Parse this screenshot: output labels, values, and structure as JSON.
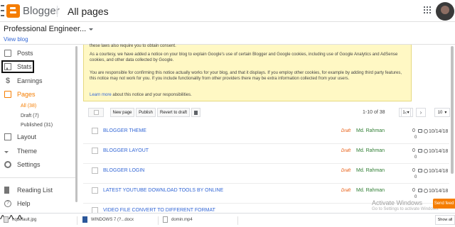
{
  "header": {
    "brand": "Blogger",
    "page_title": "All pages"
  },
  "blog": {
    "name": "Professional Engineer...",
    "view_blog": "View blog"
  },
  "sidebar": {
    "items": [
      {
        "label": "Posts",
        "icon": "posts-icon"
      },
      {
        "label": "Stats",
        "icon": "stats-icon"
      },
      {
        "label": "Earnings",
        "icon": "earnings-icon"
      },
      {
        "label": "Pages",
        "icon": "pages-icon",
        "active": true
      },
      {
        "label": "Layout",
        "icon": "layout-icon"
      },
      {
        "label": "Theme",
        "icon": "theme-icon"
      },
      {
        "label": "Settings",
        "icon": "settings-icon"
      },
      {
        "label": "Reading List",
        "icon": "reading-list-icon"
      },
      {
        "label": "Help",
        "icon": "help-icon"
      }
    ],
    "pages_sub": [
      {
        "label": "All (38)",
        "active": true
      },
      {
        "label": "Draft (7)"
      },
      {
        "label": "Published (31)"
      }
    ]
  },
  "notice": {
    "line1": "these laws also require you to obtain consent.",
    "para2": "As a courtesy, we have added a notice on your blog to explain Google's use of certain Blogger and Google cookies, including use of Google Analytics and AdSense cookies, and other data collected by Google.",
    "para3": "You are responsible for confirming this notice actually works for your blog, and that it displays. If you employ other cookies, for example by adding third party features, this notice may not work for you. If you include functionality from other providers there may be extra information collected from your users.",
    "learn_more": "Learn more",
    "learn_more_rest": " about this notice and your responsibilities."
  },
  "toolbar": {
    "new_page": "New page",
    "publish": "Publish",
    "revert": "Revert to draft",
    "count": "1-10 of 38",
    "page": "1",
    "per_page": "10"
  },
  "pages": [
    {
      "title": "BLOGGER THEME",
      "status": "Draft",
      "author": "Md. Rahman",
      "comments": "0",
      "views": "0",
      "date": "10/14/18"
    },
    {
      "title": "BLOGGER LAYOUT",
      "status": "Draft",
      "author": "Md. Rahman",
      "comments": "0",
      "views": "0",
      "date": "10/14/18"
    },
    {
      "title": "BLOGGER LOGIN",
      "status": "Draft",
      "author": "Md. Rahman",
      "comments": "0",
      "views": "0",
      "date": "10/14/18"
    },
    {
      "title": "LATEST YOUTUBE DOWNLOAD TOOLS BY ONLINE",
      "status": "Draft",
      "author": "Md. Rahman",
      "comments": "0",
      "views": "0",
      "date": "10/14/18"
    },
    {
      "title": "VIDEO FILE CONVERT TO DIFFERENT FORMAT",
      "status": "",
      "author": "",
      "comments": "",
      "views": "",
      "date": ""
    }
  ],
  "watermark": {
    "line1": "Activate Windows",
    "line2": "Go to Settings to activate Windows."
  },
  "send_feedback": "Send feed",
  "downloads": {
    "items": [
      "hqdefault.jpg",
      "WINDOWS 7 (?...docx",
      "domin.mp4"
    ],
    "show_all": "Show all"
  }
}
